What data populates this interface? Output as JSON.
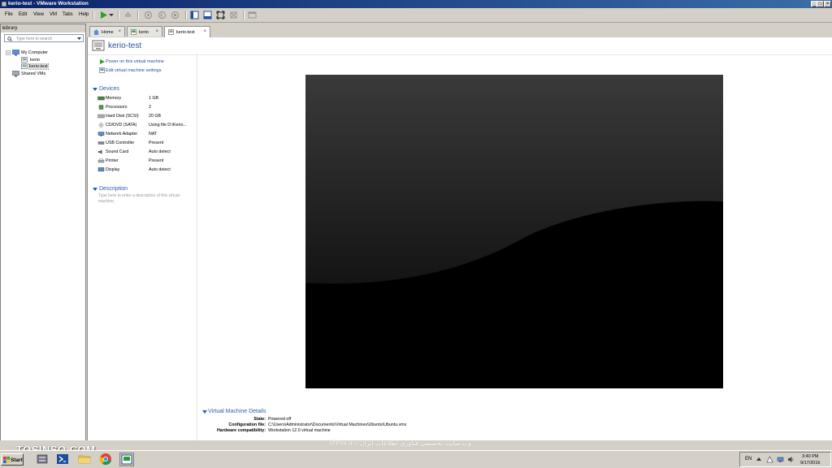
{
  "window": {
    "title": "kerio-test - VMware Workstation",
    "minimize": "_",
    "maximize": "□",
    "close": "×"
  },
  "menu": [
    "File",
    "Edit",
    "View",
    "VM",
    "Tabs",
    "Help"
  ],
  "library": {
    "title": "Library",
    "close": "×",
    "search_placeholder": "Type here to search",
    "tree": {
      "root": "My Computer",
      "vms": [
        "kerio",
        "kerio-test"
      ],
      "shared": "Shared VMs"
    }
  },
  "tabs": [
    {
      "label": "Home",
      "close": "×"
    },
    {
      "label": "kerio",
      "close": "×"
    },
    {
      "label": "kerio-test",
      "close": "×"
    }
  ],
  "vm": {
    "name": "kerio-test",
    "actions": [
      "Power on this virtual machine",
      "Edit virtual machine settings"
    ],
    "devices_title": "Devices",
    "devices": [
      {
        "name": "Memory",
        "value": "1 GB"
      },
      {
        "name": "Processors",
        "value": "2"
      },
      {
        "name": "Hard Disk (SCSI)",
        "value": "20 GB"
      },
      {
        "name": "CD/DVD (SATA)",
        "value": "Using file D:\\Kerio..."
      },
      {
        "name": "Network Adapter",
        "value": "NAT"
      },
      {
        "name": "USB Controller",
        "value": "Present"
      },
      {
        "name": "Sound Card",
        "value": "Auto detect"
      },
      {
        "name": "Printer",
        "value": "Present"
      },
      {
        "name": "Display",
        "value": "Auto detect"
      }
    ],
    "description_title": "Description",
    "description_placeholder": "Type here to enter a description of this virtual machine."
  },
  "details": {
    "title": "Virtual Machine Details",
    "rows": [
      {
        "label": "State:",
        "value": "Powered off"
      },
      {
        "label": "Configuration file:",
        "value": "C:\\Users\\Administrator\\Documents\\Virtual Machines\\Ubuntu\\Ubuntu.vmx"
      },
      {
        "label": "Hardware compatibility:",
        "value": "Workstation 12.0 virtual machine"
      }
    ]
  },
  "watermarks": {
    "left": "TOSINSO.COM",
    "center": "ITPro.ir - وب سایت تخصصی فناوری اطلاعات ایران"
  },
  "taskbar": {
    "start": "Start",
    "lang": "EN",
    "time": "3:40 PM",
    "date": "9/17/2016"
  },
  "colors": {
    "titlebar": "#0a246a",
    "link": "#1f4f9c",
    "section": "#2a5db0",
    "chrome": "#d4d0c8",
    "play": "#2e9e2e"
  }
}
